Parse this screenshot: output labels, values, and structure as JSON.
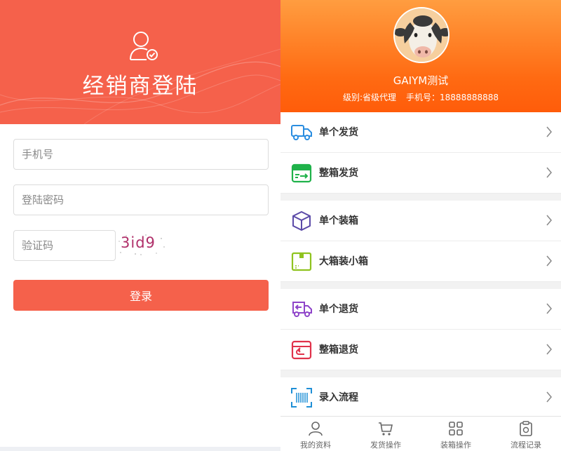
{
  "login": {
    "title": "经销商登陆",
    "phone_placeholder": "手机号",
    "password_placeholder": "登陆密码",
    "code_placeholder": "验证码",
    "captcha_text": "3id9",
    "login_button": "登录",
    "colors": {
      "primary": "#f5614b"
    }
  },
  "profile": {
    "name": "GAIYM测试",
    "level": "级别:省级代理",
    "phone": "手机号：18888888888",
    "avatar_icon": "cow-avatar-icon",
    "colors": {
      "gradient_top": "#ff9d40",
      "gradient_bottom": "#ff5c0a"
    }
  },
  "menu_groups": [
    [
      {
        "label": "单个发货",
        "icon": "truck-icon",
        "color": "#2a8de0"
      },
      {
        "label": "整箱发货",
        "icon": "box-ship-icon",
        "color": "#1fb24a"
      }
    ],
    [
      {
        "label": "单个装箱",
        "icon": "cube-icon",
        "color": "#5b4aa8"
      },
      {
        "label": "大箱装小箱",
        "icon": "big-box-icon",
        "color": "#8fc31f"
      }
    ],
    [
      {
        "label": "单个退货",
        "icon": "return-truck-icon",
        "color": "#8e44c9"
      },
      {
        "label": "整箱退货",
        "icon": "return-box-icon",
        "color": "#e0324b"
      }
    ],
    [
      {
        "label": "录入流程",
        "icon": "barcode-scan-icon",
        "color": "#1f8fd6"
      }
    ]
  ],
  "tabs": [
    {
      "label": "我的资料",
      "icon": "person-icon"
    },
    {
      "label": "发货操作",
      "icon": "cart-icon"
    },
    {
      "label": "装箱操作",
      "icon": "grid-icon"
    },
    {
      "label": "流程记录",
      "icon": "clipboard-icon"
    }
  ]
}
